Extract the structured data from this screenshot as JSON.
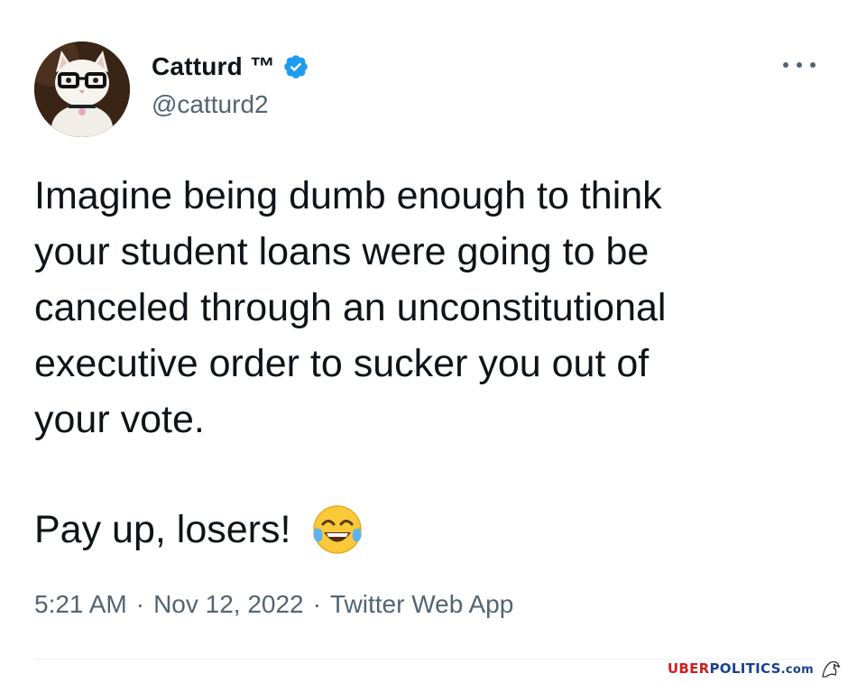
{
  "tweet": {
    "author": {
      "display_name": "Catturd ™",
      "handle": "@catturd2"
    },
    "text_paragraph_1": "Imagine being dumb enough to think\nyour student loans were going to be\ncanceled through an unconstitutional\nexecutive order to sucker you out of\nyour vote.",
    "text_paragraph_2": "Pay up, losers!",
    "timestamp": {
      "time": "5:21 AM",
      "separator": "·",
      "date": "Nov 12, 2022",
      "source": "Twitter Web App"
    }
  },
  "watermark": {
    "uber": "UBER",
    "politics": "POLITICS",
    "dotcom": ".com"
  },
  "icons": {
    "verified": "verified-badge-icon",
    "more": "more-options-icon",
    "emoji": "face-with-tears-of-joy-emoji"
  },
  "colors": {
    "text_primary": "#0f1419",
    "text_secondary": "#536471",
    "verified_blue": "#1d9bf0",
    "watermark_red": "#d11f1f",
    "watermark_blue": "#1a3f8f"
  }
}
